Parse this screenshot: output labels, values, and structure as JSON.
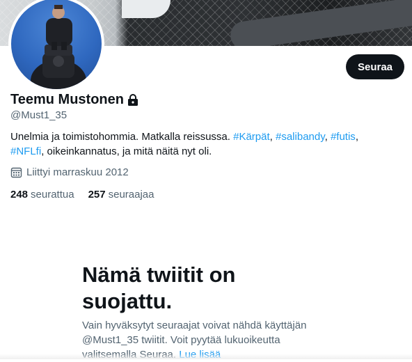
{
  "profile": {
    "display_name": "Teemu Mustonen",
    "handle": "@Must1_35",
    "bio_parts": [
      {
        "text": "Unelmia ja toimistohommia. Matkalla reissussa. ",
        "link": false
      },
      {
        "text": "#Kärpät",
        "link": true
      },
      {
        "text": ", ",
        "link": false
      },
      {
        "text": "#salibandy",
        "link": true
      },
      {
        "text": ", ",
        "link": false
      },
      {
        "text": "#futis",
        "link": true
      },
      {
        "text": ", ",
        "link": false
      },
      {
        "text": "#NFLfi",
        "link": true
      },
      {
        "text": ", oikeinkannatus, ja mitä näitä nyt oli.",
        "link": false
      }
    ],
    "joined": "Liittyi marraskuu 2012",
    "following_count": "248",
    "following_label": "seurattua",
    "followers_count": "257",
    "followers_label": "seuraajaa",
    "verified_lock": true
  },
  "actions": {
    "follow_label": "Seuraa"
  },
  "protected": {
    "title": "Nämä twiitit on suojattu.",
    "text_before_link": "Vain hyväksytyt seuraajat voivat nähdä käyttäjän @Must1_35 twiitit. Voit pyytää lukuoikeutta valitsemalla Seuraa. ",
    "link_label": "Lue lisää"
  },
  "colors": {
    "link": "#1d9bf0",
    "text": "#0f1419",
    "secondary": "#536471",
    "button_bg": "#0f1419"
  },
  "icons": {
    "lock": "lock-icon",
    "calendar": "calendar-icon"
  }
}
